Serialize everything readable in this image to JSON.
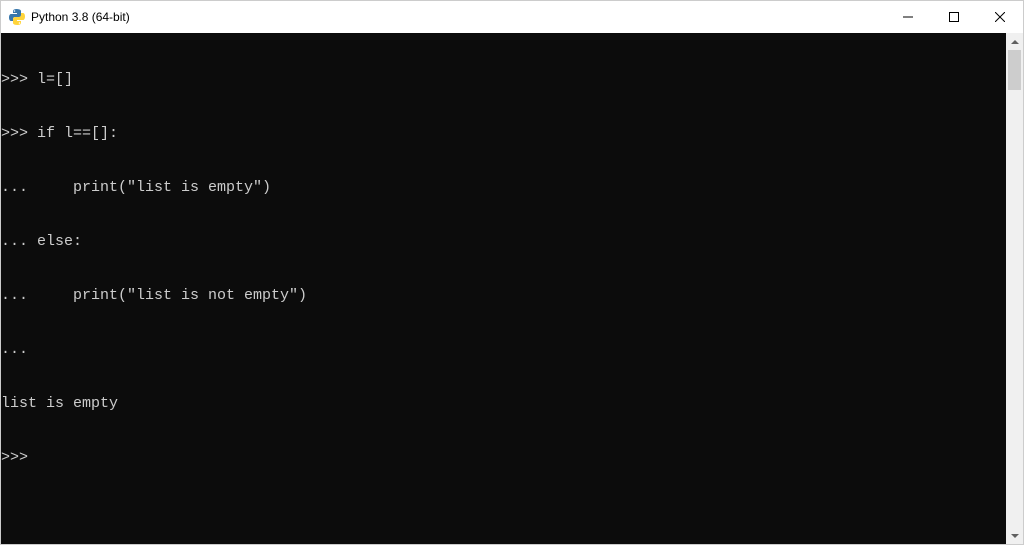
{
  "window": {
    "title": "Python 3.8 (64-bit)"
  },
  "console": {
    "lines": [
      ">>> l=[]",
      ">>> if l==[]:",
      "...     print(\"list is empty\")",
      "... else:",
      "...     print(\"list is not empty\")",
      "...",
      "list is empty",
      ">>>"
    ]
  }
}
